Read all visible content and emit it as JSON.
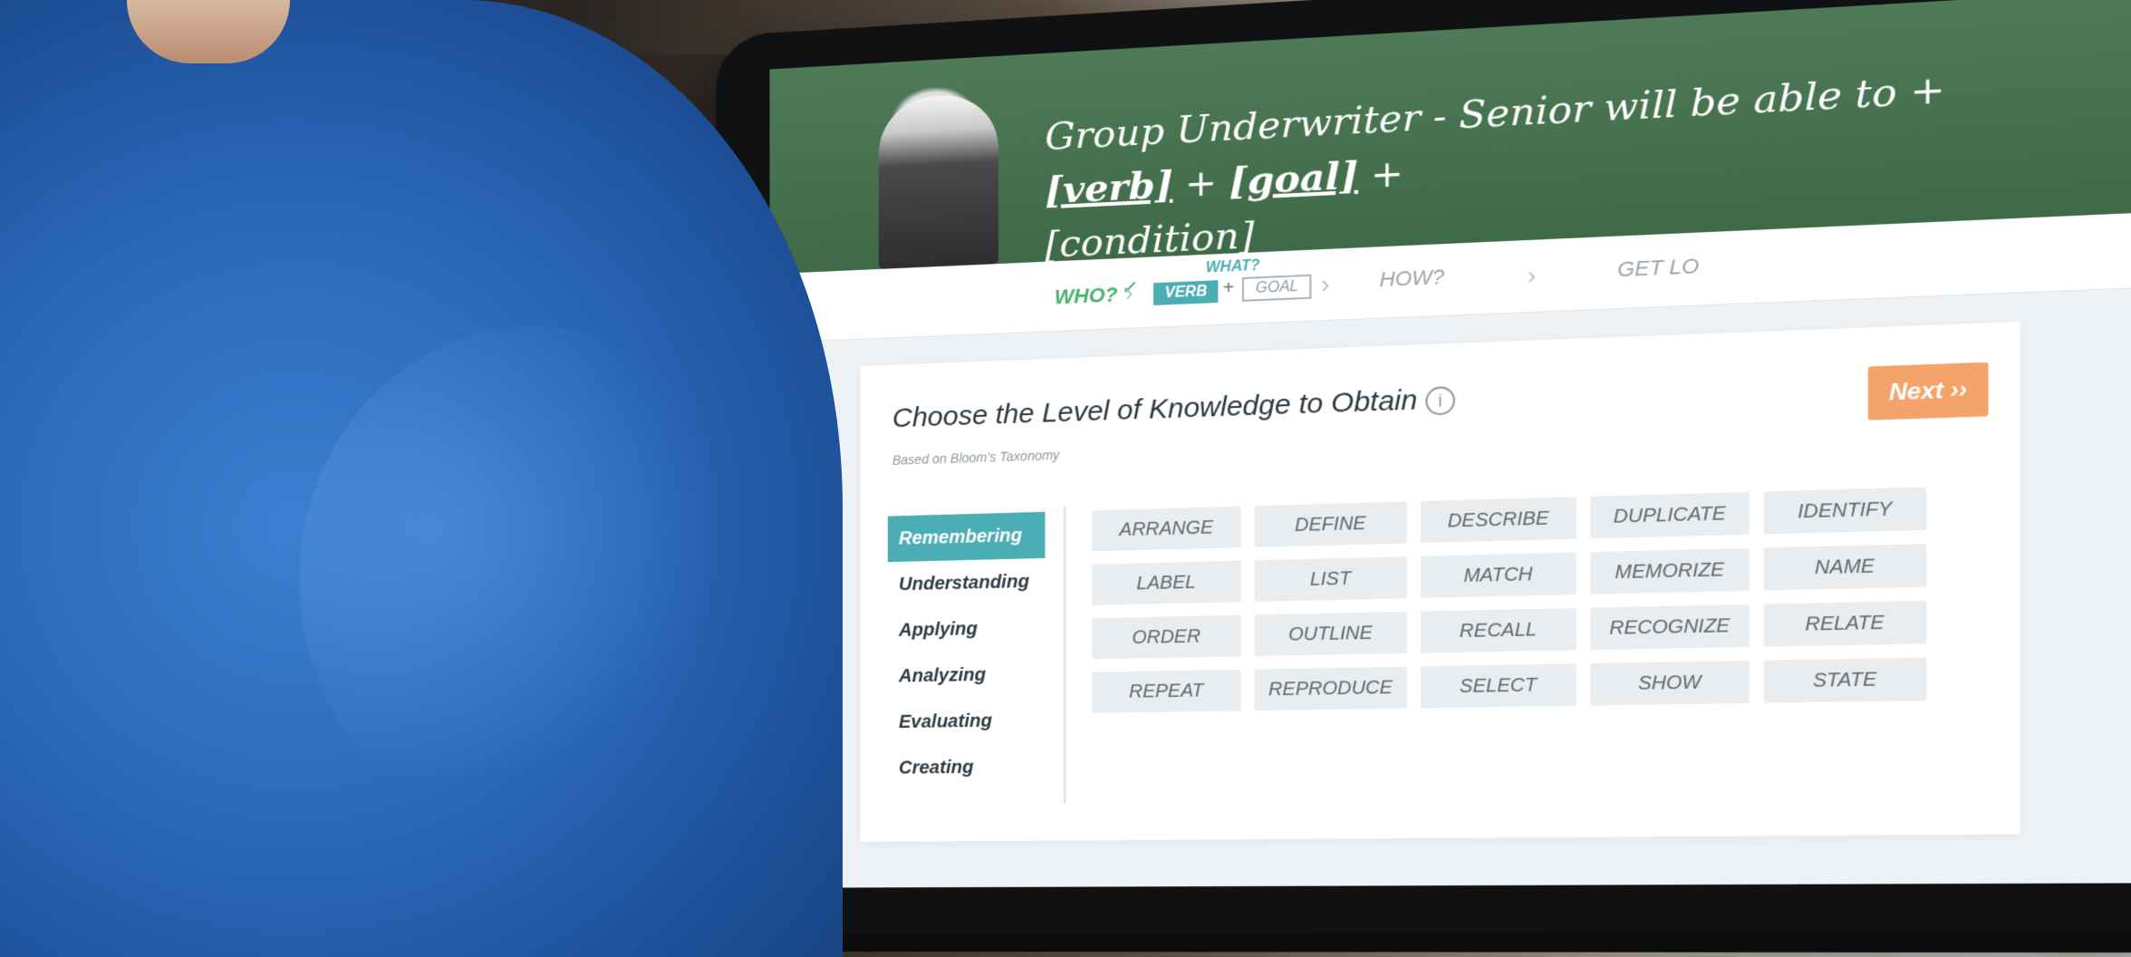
{
  "banner": {
    "subject": "Group Underwriter - Senior",
    "phrase": " will be able to + ",
    "verb_token": "[verb]",
    "plus": " + ",
    "goal_token": "[goal]",
    "tail": " + ",
    "condition_token": "[condition]"
  },
  "wizard": {
    "who": "WHO?",
    "what": "WHAT?",
    "verb_chip": "VERB",
    "plus": "+",
    "goal_chip": "GOAL",
    "how": "HOW?",
    "get_lo": "GET LO",
    "chevron": "›",
    "who_check_icon": "check-circle-icon"
  },
  "card": {
    "title": "Choose the Level of Knowledge to Obtain",
    "info_icon_glyph": "i",
    "subtitle": "Based on Bloom's Taxonomy",
    "next_label": "Next ››"
  },
  "levels": [
    "Remembering",
    "Understanding",
    "Applying",
    "Analyzing",
    "Evaluating",
    "Creating"
  ],
  "active_level": "Remembering",
  "verbs": [
    "ARRANGE",
    "DEFINE",
    "DESCRIBE",
    "DUPLICATE",
    "IDENTIFY",
    "LABEL",
    "LIST",
    "MATCH",
    "MEMORIZE",
    "NAME",
    "ORDER",
    "OUTLINE",
    "RECALL",
    "RECOGNIZE",
    "RELATE",
    "REPEAT",
    "REPRODUCE",
    "SELECT",
    "SHOW",
    "STATE"
  ],
  "colors": {
    "chalkboard": "#3f6a48",
    "accent_teal": "#4aaeb4",
    "who_green": "#49b26a",
    "next_orange": "#f4a36a"
  }
}
